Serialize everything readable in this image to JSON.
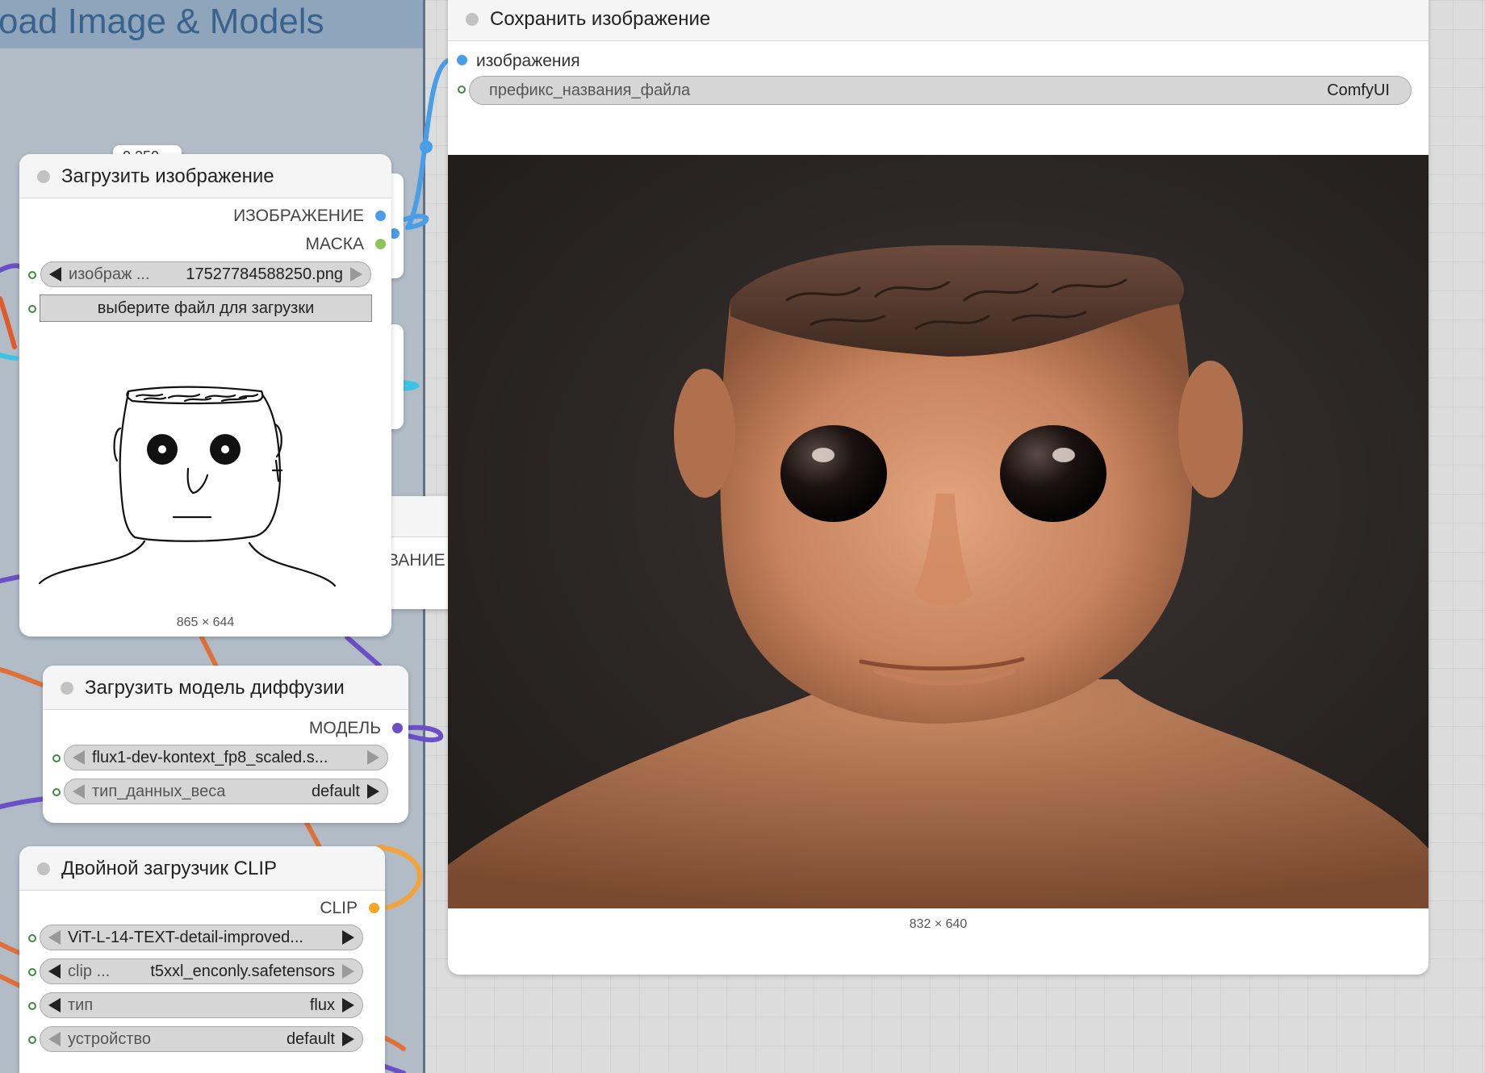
{
  "group": {
    "title": "oad Image & Models"
  },
  "hidden_labels": {
    "partial_value": "0.250",
    "partial_output": "ВАНИЕ"
  },
  "save_node": {
    "title": "Сохранить изображение",
    "input_label": "изображения",
    "prefix_name": "префикс_названия_файла",
    "prefix_value": "ComfyUI",
    "image_dims": "832 × 640"
  },
  "load_image_node": {
    "title": "Загрузить изображение",
    "outputs": [
      "ИЗОБРАЖЕНИЕ",
      "МАСКА"
    ],
    "image_widget_name": "изображ ...",
    "image_widget_value": "17527784588250.png",
    "upload_button": "выберите файл для загрузки",
    "image_dims": "865 × 644"
  },
  "diffusion_node": {
    "title": "Загрузить модель диффузии",
    "output": "МОДЕЛЬ",
    "model_value": "flux1-dev-kontext_fp8_scaled.s...",
    "dtype_name": "тип_данных_веса",
    "dtype_value": "default"
  },
  "clip_node": {
    "title": "Двойной загрузчик CLIP",
    "output": "CLIP",
    "clip1_value": "ViT-L-14-TEXT-detail-improved...",
    "clip2_name": "clip ...",
    "clip2_value": "t5xxl_enconly.safetensors",
    "type_name": "тип",
    "type_value": "flux",
    "device_name": "устройство",
    "device_value": "default"
  },
  "colors": {
    "image_slot": "#4a9ee8",
    "mask_slot": "#8dc35a",
    "model_slot": "#6a4fc6",
    "clip_slot": "#f5a623"
  },
  "icons": [
    "left-arrow-icon",
    "right-arrow-icon",
    "status-dot-icon"
  ]
}
